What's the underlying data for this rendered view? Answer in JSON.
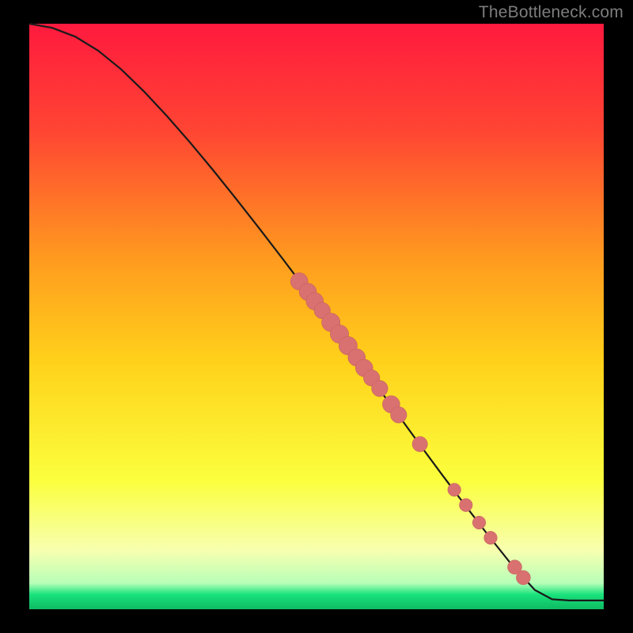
{
  "watermark": "TheBottleneck.com",
  "colors": {
    "top": "#ff1a3e",
    "upper": "#ff5a36",
    "mid": "#ffd21a",
    "low": "#fdff77",
    "green": "#18e27c",
    "curve": "#1a1a1a",
    "dot": "#d8716f",
    "dotStroke": "#c25e5c"
  },
  "chart_data": {
    "type": "line",
    "title": "",
    "xlabel": "",
    "ylabel": "",
    "xlim": [
      0,
      100
    ],
    "ylim": [
      0,
      100
    ],
    "x": [
      0,
      4,
      8,
      12,
      16,
      20,
      24,
      28,
      32,
      36,
      40,
      44,
      48,
      52,
      56,
      60,
      64,
      68,
      72,
      76,
      80,
      84,
      88,
      91,
      94,
      97,
      100
    ],
    "y": [
      100,
      99.3,
      97.8,
      95.4,
      92.2,
      88.4,
      84.2,
      79.7,
      75.0,
      70.1,
      65.1,
      60.0,
      54.8,
      49.5,
      44.2,
      38.8,
      33.5,
      28.1,
      22.8,
      17.6,
      12.5,
      7.6,
      3.3,
      1.7,
      1.5,
      1.5,
      1.5
    ],
    "highlight_points": [
      {
        "x": 47.0,
        "y": 56.0,
        "r": 1.6
      },
      {
        "x": 48.5,
        "y": 54.2,
        "r": 1.6
      },
      {
        "x": 49.7,
        "y": 52.6,
        "r": 1.6
      },
      {
        "x": 51.0,
        "y": 51.0,
        "r": 1.5
      },
      {
        "x": 52.5,
        "y": 49.0,
        "r": 1.7
      },
      {
        "x": 54.0,
        "y": 47.0,
        "r": 1.7
      },
      {
        "x": 55.5,
        "y": 45.0,
        "r": 1.7
      },
      {
        "x": 57.0,
        "y": 43.0,
        "r": 1.6
      },
      {
        "x": 58.3,
        "y": 41.2,
        "r": 1.6
      },
      {
        "x": 59.6,
        "y": 39.5,
        "r": 1.5
      },
      {
        "x": 61.0,
        "y": 37.7,
        "r": 1.5
      },
      {
        "x": 63.0,
        "y": 35.0,
        "r": 1.6
      },
      {
        "x": 64.3,
        "y": 33.2,
        "r": 1.5
      },
      {
        "x": 68.0,
        "y": 28.2,
        "r": 1.4
      },
      {
        "x": 74.0,
        "y": 20.4,
        "r": 1.2
      },
      {
        "x": 76.0,
        "y": 17.8,
        "r": 1.2
      },
      {
        "x": 78.3,
        "y": 14.8,
        "r": 1.2
      },
      {
        "x": 80.3,
        "y": 12.2,
        "r": 1.2
      },
      {
        "x": 84.5,
        "y": 7.2,
        "r": 1.3
      },
      {
        "x": 86.0,
        "y": 5.4,
        "r": 1.3
      }
    ]
  }
}
